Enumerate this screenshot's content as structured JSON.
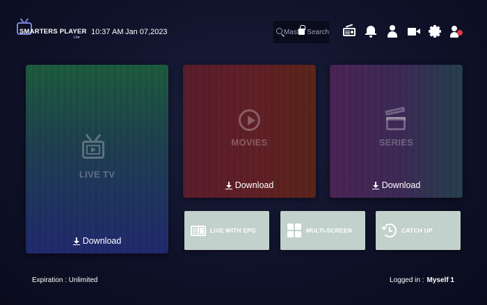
{
  "header": {
    "logo_name": "SMARTERS PLAYER",
    "logo_sub": "Lite",
    "time": "10:37 AM",
    "date": "Jan 07,2023",
    "search_text": "Master Search"
  },
  "toolbar_icons": [
    "radio-icon",
    "bell-icon",
    "user-icon",
    "camera-icon",
    "gear-icon",
    "switch-user-icon"
  ],
  "tiles": {
    "live_tv": {
      "label": "LIVE TV",
      "download": "Download",
      "icon": "tv-icon"
    },
    "movies": {
      "label": "MOVIES",
      "download": "Download",
      "icon": "play-circle-icon"
    },
    "series": {
      "label": "SERIES",
      "download": "Download",
      "icon": "clapperboard-icon"
    }
  },
  "buttons": {
    "epg": {
      "label": "LIVE WITH EPG",
      "icon": "epg-icon"
    },
    "multi": {
      "label": "MULTI-SCREEN",
      "icon": "multi-screen-icon"
    },
    "catch": {
      "label": "CATCH UP",
      "icon": "catch-up-icon"
    }
  },
  "footer": {
    "expiration": "Expiration : Unlimited",
    "logged_label": "Logged in :",
    "logged_user": "Myself 1"
  },
  "colors": {
    "background": "#0f1229",
    "small_button": "#c2d1cb",
    "badge": "#e13b3b"
  }
}
